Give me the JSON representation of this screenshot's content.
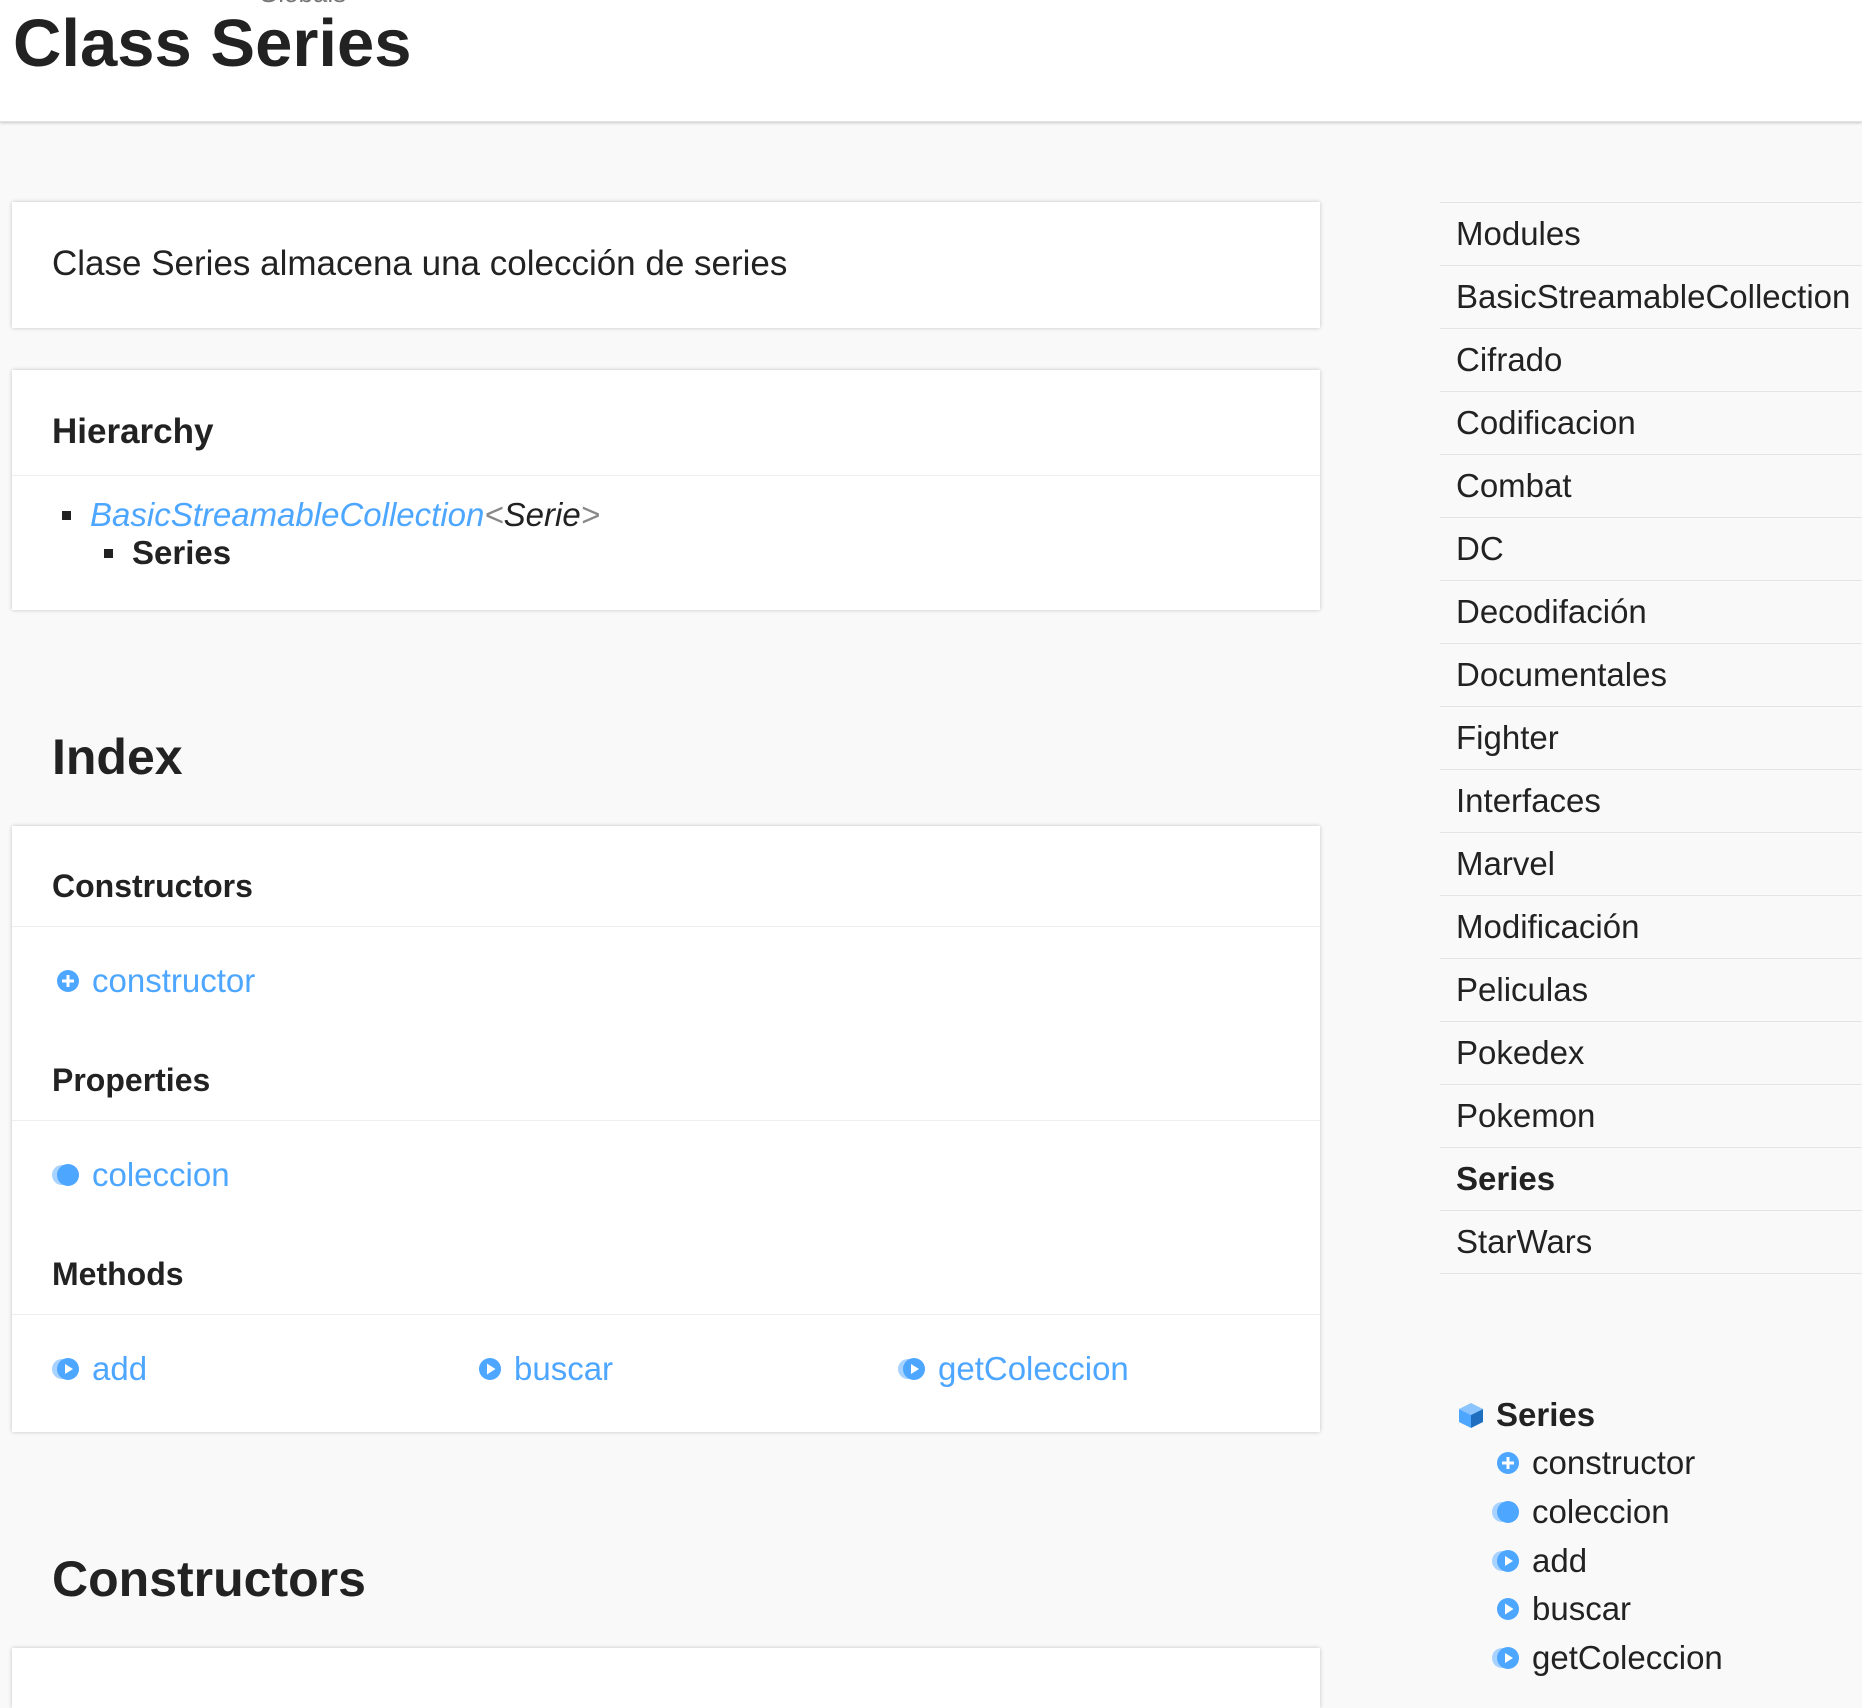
{
  "header": {
    "breadcrumb": "Globals",
    "title": "Class Series"
  },
  "comment": "Clase Series almacena una colección de series",
  "hierarchy": {
    "heading": "Hierarchy",
    "parent_link": "BasicStreamableCollection",
    "lt": "<",
    "type_arg": "Serie",
    "gt": ">",
    "child": "Series"
  },
  "index": {
    "heading": "Index",
    "constructors": {
      "heading": "Constructors",
      "items": [
        "constructor"
      ]
    },
    "properties": {
      "heading": "Properties",
      "items": [
        "coleccion"
      ]
    },
    "methods": {
      "heading": "Methods",
      "items": [
        "add",
        "buscar",
        "getColeccion"
      ]
    }
  },
  "constructors_section": {
    "heading": "Constructors"
  },
  "sidebar": {
    "nav": [
      {
        "label": "Modules",
        "active": false
      },
      {
        "label": "BasicStreamableCollection",
        "active": false
      },
      {
        "label": "Cifrado",
        "active": false
      },
      {
        "label": "Codificacion",
        "active": false
      },
      {
        "label": "Combat",
        "active": false
      },
      {
        "label": "DC",
        "active": false
      },
      {
        "label": "Decodifación",
        "active": false
      },
      {
        "label": "Documentales",
        "active": false
      },
      {
        "label": "Fighter",
        "active": false
      },
      {
        "label": "Interfaces",
        "active": false
      },
      {
        "label": "Marvel",
        "active": false
      },
      {
        "label": "Modificación",
        "active": false
      },
      {
        "label": "Peliculas",
        "active": false
      },
      {
        "label": "Pokedex",
        "active": false
      },
      {
        "label": "Pokemon",
        "active": false
      },
      {
        "label": "Series",
        "active": true
      },
      {
        "label": "StarWars",
        "active": false
      }
    ],
    "toc": {
      "parent": "Series",
      "children": [
        "constructor",
        "coleccion",
        "add",
        "buscar",
        "getColeccion"
      ]
    }
  },
  "colors": {
    "link": "#4da6ff",
    "icon": "#4da6ff",
    "text": "#222222"
  },
  "icons": {
    "constructor": "constructor-icon",
    "property": "property-icon",
    "method": "method-icon",
    "inherited_method": "inherited-method-icon",
    "class": "class-cube-icon"
  }
}
